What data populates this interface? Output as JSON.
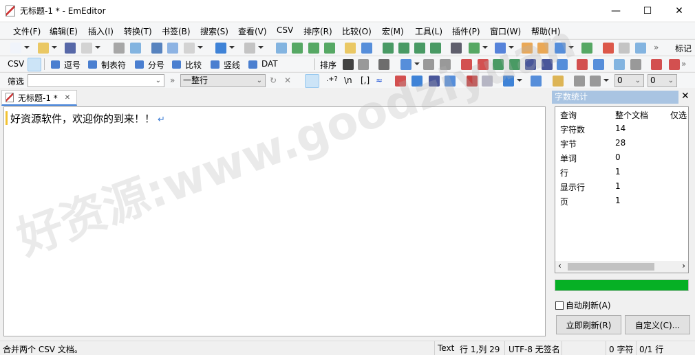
{
  "window": {
    "title": "无标题-1 * - EmEditor",
    "minimize": "—",
    "maximize": "☐",
    "close": "✕"
  },
  "menu": [
    "文件(F)",
    "编辑(E)",
    "插入(I)",
    "转换(T)",
    "书签(B)",
    "搜索(S)",
    "查看(V)",
    "CSV",
    "排序(R)",
    "比较(O)",
    "宏(M)",
    "工具(L)",
    "插件(P)",
    "窗口(W)",
    "帮助(H)"
  ],
  "toolbar1": {
    "overflow": "»",
    "bookmark_label": "标记"
  },
  "toolbar2": {
    "csv_label": "CSV",
    "modes": [
      "逗号",
      "制表符",
      "分号",
      "比较",
      "竖线",
      "DAT"
    ],
    "sort_label": "排序",
    "overflow": "»"
  },
  "toolbar3": {
    "filter_label": "筛选",
    "filter_value": "",
    "overflow": "»",
    "match_mode": "一整行",
    "regex": ".+?",
    "newline": "\\n",
    "brackets": "[,]",
    "combo1": "0",
    "combo2": "0"
  },
  "tab": {
    "label": "无标题-1 *",
    "close": "✕"
  },
  "editor": {
    "text": "好资源软件，欢迎你的到来！！",
    "eol_mark": "↵"
  },
  "watermark": "好资源:www.goodziyuan",
  "panel": {
    "title": "字数统计",
    "close": "✕",
    "columns": [
      "查询",
      "整个文档",
      "仅选"
    ],
    "rows": [
      [
        "字符数",
        "14"
      ],
      [
        "字节",
        "28"
      ],
      [
        "单词",
        "0"
      ],
      [
        "行",
        "1"
      ],
      [
        "显示行",
        "1"
      ],
      [
        "页",
        "1"
      ]
    ],
    "progress": 100,
    "auto_refresh": {
      "label": "自动刷新(A)",
      "checked": false
    },
    "refresh_button": "立即刷新(R)",
    "custom_button": "自定义(C)...",
    "scroll_left": "‹",
    "scroll_right": "›"
  },
  "status": {
    "message": "合并两个 CSV 文档。",
    "mode": "Text",
    "position": "行 1,列 29",
    "encoding": "UTF-8 无签名",
    "chars": "0 字符",
    "lines": "0/1 行"
  },
  "colors": {
    "accent": "#3a7bd5",
    "progress": "#06b025",
    "panel_title": "#a9c4e2"
  }
}
